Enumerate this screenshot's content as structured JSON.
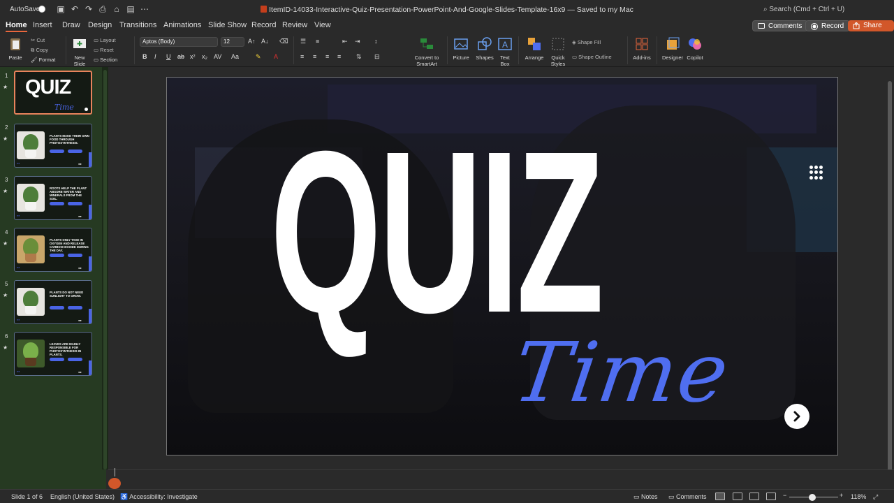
{
  "titlebar": {
    "autosave_label": "AutoSave",
    "document_title": "ItemID-14033-Interactive-Quiz-Presentation-PowerPoint-And-Google-Slides-Template-16x9 — Saved to my Mac",
    "search_label": "Search (Cmd + Ctrl + U)"
  },
  "tabs": [
    "Home",
    "Insert",
    "Draw",
    "Design",
    "Transitions",
    "Animations",
    "Slide Show",
    "Record",
    "Review",
    "View"
  ],
  "active_tab": "Home",
  "actions": {
    "comments": "Comments",
    "record": "Record",
    "share": "Share"
  },
  "ribbon": {
    "paste": "Paste",
    "cut": "Cut",
    "copy": "Copy",
    "format": "Format",
    "new_slide": "New Slide",
    "layout": "Layout",
    "reset": "Reset",
    "section": "Section",
    "font_name": "Aptos (Body)",
    "font_size": "12",
    "convert_smartart": "Convert to SmartArt",
    "picture": "Picture",
    "shapes": "Shapes",
    "text_box": "Text Box",
    "arrange": "Arrange",
    "quick_styles": "Quick Styles",
    "shape_fill": "Shape Fill",
    "shape_outline": "Shape Outline",
    "add_ins": "Add-ins",
    "designer": "Designer",
    "copilot": "Copilot"
  },
  "slides": [
    {
      "num": "1",
      "type": "title",
      "quiz": "QUIZ",
      "time": "Time"
    },
    {
      "num": "2",
      "text": "PLANTS MAKE THEIR OWN FOOD THROUGH PHOTOSYNTHESIS."
    },
    {
      "num": "3",
      "text": "ROOTS HELP THE PLANT ABSORB WATER AND MINERALS FROM THE SOIL."
    },
    {
      "num": "4",
      "text": "PLANTS ONLY TAKE IN OXYGEN AND RELEASE CARBON DIOXIDE DURING THE DAY."
    },
    {
      "num": "5",
      "text": "PLANTS DO NOT NEED SUNLIGHT TO GROW."
    },
    {
      "num": "6",
      "text": "LEAVES ARE MAINLY RESPONSIBLE FOR PHOTOSYNTHESIS IN PLANTS."
    }
  ],
  "main_slide": {
    "title": "QUIZ",
    "subtitle": "Time"
  },
  "status": {
    "slide_info": "Slide 1 of 6",
    "language": "English (United States)",
    "accessibility": "Accessibility: Investigate",
    "notes": "Notes",
    "comments": "Comments",
    "zoom": "118%"
  },
  "colors": {
    "accent": "#d2572a",
    "quiz_blue": "#4f6ef0",
    "panel_green": "#263a22"
  }
}
